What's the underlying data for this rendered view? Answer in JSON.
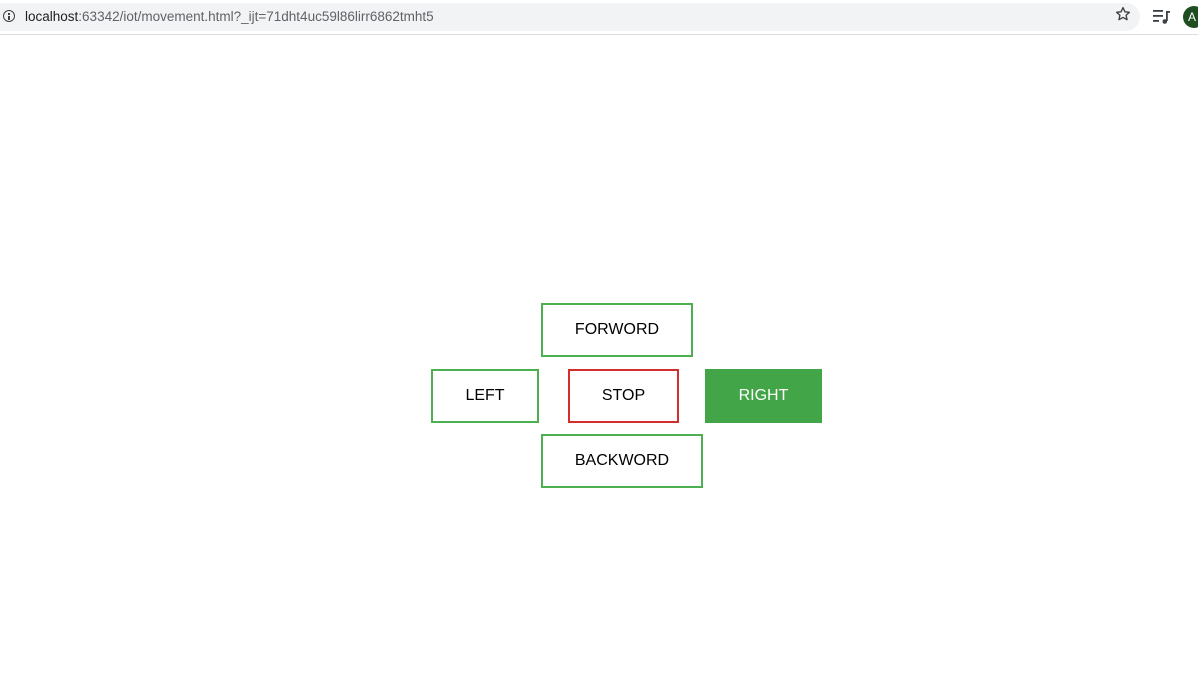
{
  "browser": {
    "url_host": "localhost",
    "url_rest": ":63342/iot/movement.html?_ijt=71dht4uc59l86lirr6862tmht5",
    "avatar_letter": "A",
    "icons": [
      "info-icon",
      "star-icon",
      "playlist-icon",
      "avatar"
    ]
  },
  "controls": {
    "forward_label": "FORWORD",
    "left_label": "LEFT",
    "stop_label": "STOP",
    "right_label": "RIGHT",
    "backward_label": "BACKWORD"
  },
  "colors": {
    "green_border": "#4caf50",
    "red_border": "#d32f2f",
    "green_fill": "#42a548"
  }
}
